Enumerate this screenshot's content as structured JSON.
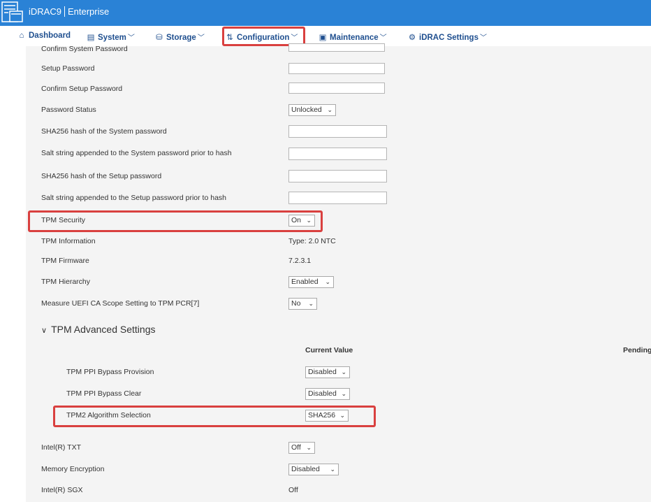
{
  "header": {
    "product": "iDRAC9",
    "edition": "Enterprise"
  },
  "nav": {
    "dashboard": "Dashboard",
    "system": "System",
    "storage": "Storage",
    "configuration": "Configuration",
    "maintenance": "Maintenance",
    "idrac_settings": "iDRAC Settings"
  },
  "fields": {
    "confirm_system_password": "Confirm System Password",
    "setup_password": "Setup Password",
    "confirm_setup_password": "Confirm Setup Password",
    "password_status": "Password Status",
    "password_status_value": "Unlocked",
    "sha256_system": "SHA256 hash of the System password",
    "salt_system": "Salt string appended to the System password prior to hash",
    "sha256_setup": "SHA256 hash of the Setup password",
    "salt_setup": "Salt string appended to the Setup password prior to hash",
    "tpm_security": "TPM Security",
    "tpm_security_value": "On",
    "tpm_information": "TPM Information",
    "tpm_information_value": "Type: 2.0 NTC",
    "tpm_firmware": "TPM Firmware",
    "tpm_firmware_value": "7.2.3.1",
    "tpm_hierarchy": "TPM Hierarchy",
    "tpm_hierarchy_value": "Enabled",
    "measure_uefi": "Measure UEFI CA Scope Setting to TPM PCR[7]",
    "measure_uefi_value": "No"
  },
  "advanced": {
    "title": "TPM Advanced Settings",
    "col_current": "Current Value",
    "col_pending": "Pending",
    "ppi_bypass_provision": "TPM PPI Bypass Provision",
    "ppi_bypass_provision_value": "Disabled",
    "ppi_bypass_clear": "TPM PPI Bypass Clear",
    "ppi_bypass_clear_value": "Disabled",
    "tpm2_algorithm": "TPM2 Algorithm Selection",
    "tpm2_algorithm_value": "SHA256"
  },
  "bottom": {
    "intel_txt": "Intel(R) TXT",
    "intel_txt_value": "Off",
    "memory_encryption": "Memory Encryption",
    "memory_encryption_value": "Disabled",
    "intel_sgx": "Intel(R) SGX",
    "intel_sgx_value": "Off"
  },
  "icons": {
    "logo": "server-rack-icon",
    "dashboard": "home-icon",
    "system": "server-icon",
    "storage": "database-icon",
    "configuration": "sliders-icon",
    "maintenance": "monitor-icon",
    "idrac_settings": "gears-icon"
  },
  "colors": {
    "header": "#2a82d6",
    "nav_text": "#1f4f8f",
    "highlight": "#d9403f",
    "panel": "#f4f4f4"
  }
}
